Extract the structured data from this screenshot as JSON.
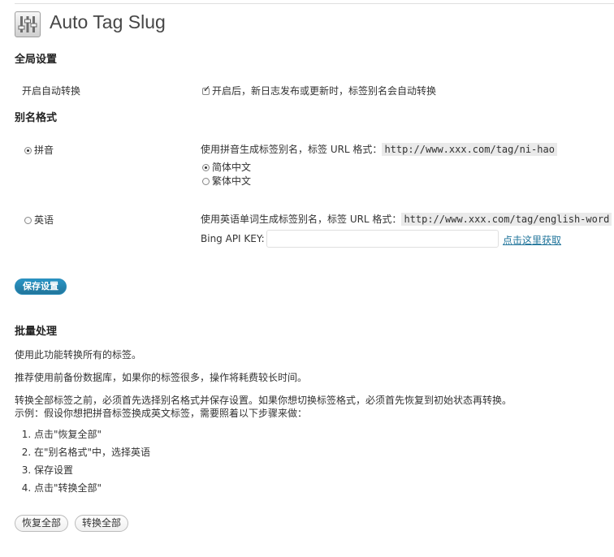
{
  "page": {
    "title": "Auto Tag Slug",
    "icon": "plugin-settings-icon"
  },
  "global": {
    "heading": "全局设置",
    "auto_convert_label": "开启自动转换",
    "auto_convert_checked": true,
    "auto_convert_desc": "开启后，新日志发布或更新时，标签别名会自动转换"
  },
  "format": {
    "heading": "别名格式",
    "pinyin": {
      "label": "拼音",
      "selected": true,
      "desc": "使用拼音生成标签别名，标签 URL 格式：",
      "url": "http://www.xxx.com/tag/ni-hao",
      "options": [
        {
          "label": "简体中文",
          "selected": true
        },
        {
          "label": "繁体中文",
          "selected": false
        }
      ]
    },
    "english": {
      "label": "英语",
      "selected": false,
      "desc": "使用英语单词生成标签别名，标签 URL 格式：",
      "url": "http://www.xxx.com/tag/english-word",
      "api_label": "Bing API KEY:",
      "api_value": "",
      "api_link": "点击这里获取"
    }
  },
  "save_button": "保存设置",
  "batch": {
    "heading": "批量处理",
    "p1": "使用此功能转换所有的标签。",
    "p2": "推荐使用前备份数据库，如果你的标签很多，操作将耗费较长时间。",
    "p3_line1": "转换全部标签之前，必须首先选择别名格式并保存设置。如果你想切换标签格式，必须首先恢复到初始状态再转换。",
    "p3_line2": "示例：假设你想把拼音标签换成英文标签，需要照着以下步骤来做：",
    "steps": [
      "点击\"恢复全部\"",
      "在\"别名格式\"中，选择英语",
      "保存设置",
      "点击\"转换全部\""
    ],
    "restore_button": "恢复全部",
    "convert_button": "转换全部"
  },
  "colors": {
    "accent": "#21759b",
    "text": "#333333",
    "code_bg": "#eaeaea"
  }
}
